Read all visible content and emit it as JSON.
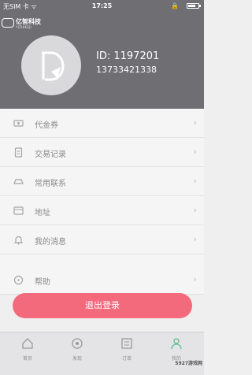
{
  "status": {
    "carrier": "无SIM 卡 ᯤ",
    "time": "17:25",
    "lock": "🔒"
  },
  "header": {
    "logo_text": "亿智科技",
    "logo_sub": "YIZHIKEJI",
    "user_id": "ID: 1197201",
    "phone": "13733421338"
  },
  "menu": {
    "items": [
      {
        "label": "代金券",
        "icon": "coupon-icon"
      },
      {
        "label": "交易记录",
        "icon": "record-icon"
      },
      {
        "label": "常用联系",
        "icon": "contacts-icon"
      },
      {
        "label": "地址",
        "icon": "address-icon"
      },
      {
        "label": "我的消息",
        "icon": "bell-icon"
      },
      {
        "label": "帮助",
        "icon": "help-icon"
      }
    ],
    "chevron": "›"
  },
  "logout_label": "退出登录",
  "tabs": [
    {
      "label": "首页",
      "icon": "home-icon"
    },
    {
      "label": "发现",
      "icon": "discover-icon"
    },
    {
      "label": "订单",
      "icon": "orders-icon"
    },
    {
      "label": "我的",
      "icon": "profile-icon"
    }
  ],
  "watermark": "5927游戏网",
  "colors": {
    "header_bg": "#6e6e73",
    "logout_bg": "#f46a7d",
    "page_bg": "#f5f5f5"
  }
}
